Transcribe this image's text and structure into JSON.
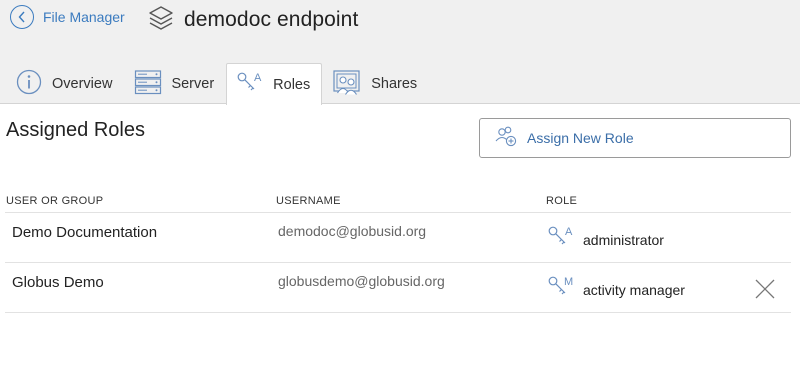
{
  "header": {
    "back_label": "File Manager",
    "title": "demodoc endpoint",
    "title_icon": "layers-icon"
  },
  "tabs": [
    {
      "label": "Overview",
      "icon": "info-icon",
      "active": false
    },
    {
      "label": "Server",
      "icon": "server-icon",
      "active": false
    },
    {
      "label": "Roles",
      "icon": "roles-key-icon",
      "active": true
    },
    {
      "label": "Shares",
      "icon": "shares-icon",
      "active": false
    }
  ],
  "main": {
    "section_title": "Assigned Roles",
    "assign_button_label": "Assign New Role",
    "assign_button_icon": "add-users-icon"
  },
  "table": {
    "columns": [
      "USER OR GROUP",
      "USERNAME",
      "ROLE"
    ],
    "rows": [
      {
        "name": "Demo Documentation",
        "username": "demodoc@globusid.org",
        "role": "administrator",
        "role_letter": "A",
        "removable": false
      },
      {
        "name": "Globus Demo",
        "username": "globusdemo@globusid.org",
        "role": "activity manager",
        "role_letter": "M",
        "removable": true
      }
    ]
  },
  "colors": {
    "accent": "#3b7bbf",
    "icon_blue": "#6a8fbf",
    "header_bg": "#f0f0f0"
  }
}
